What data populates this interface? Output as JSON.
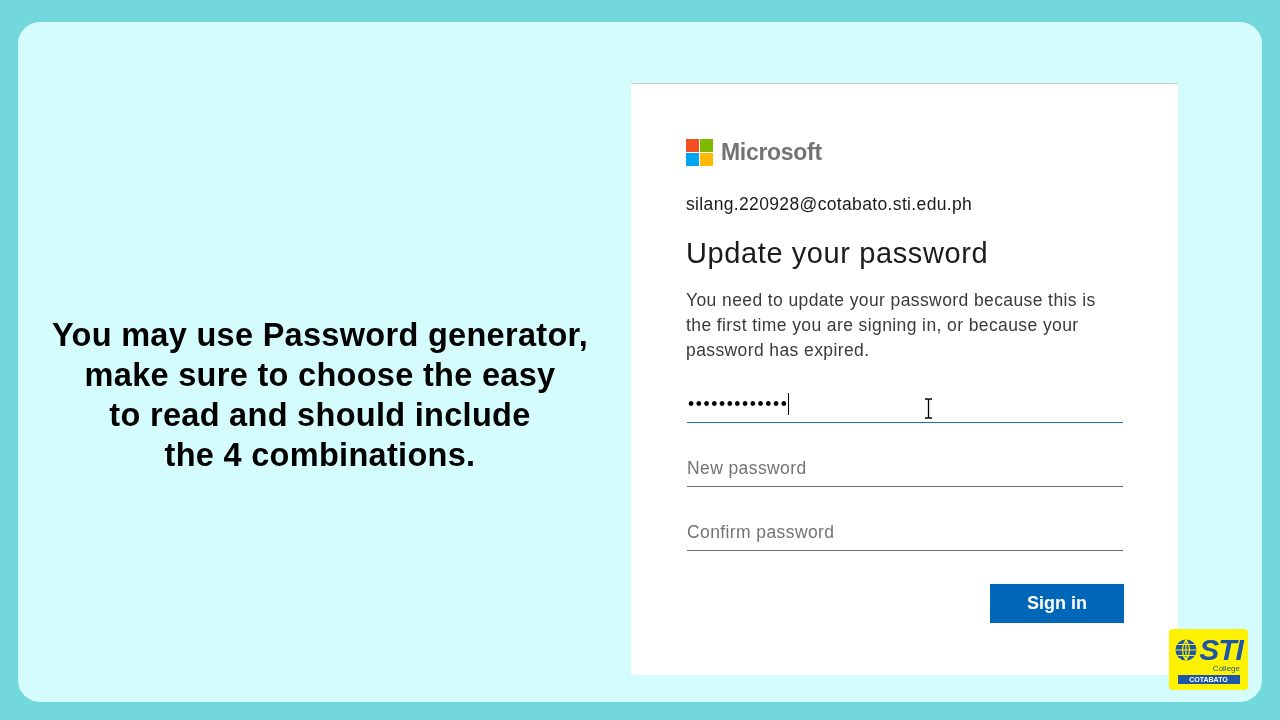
{
  "instruction_text": "You may use Password generator,\nmake sure to choose the easy\nto read and should include\nthe 4 combinations.",
  "signin_card": {
    "brand": "Microsoft",
    "account": "silang.220928@cotabato.sti.edu.ph",
    "title": "Update your password",
    "description": "You need to update your password because this is the first time you are signing in, or because your password has expired.",
    "fields": [
      {
        "value": "•••••••••••••",
        "focused": true
      },
      {
        "placeholder": "New password",
        "focused": false
      },
      {
        "placeholder": "Confirm password",
        "focused": false
      }
    ],
    "button": "Sign in"
  },
  "college_logo": {
    "name": "STI",
    "subtitle": "College",
    "campus": "COTABATO"
  }
}
